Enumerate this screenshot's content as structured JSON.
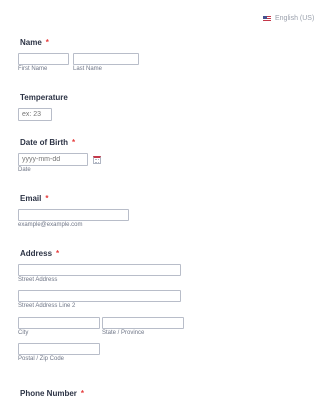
{
  "language": {
    "label": "English (US)",
    "icon": "us-flag-icon"
  },
  "fields": {
    "name": {
      "label": "Name",
      "required_mark": "*",
      "first_sub": "First Name",
      "last_sub": "Last Name"
    },
    "temperature": {
      "label": "Temperature",
      "placeholder": "ex: 23"
    },
    "dob": {
      "label": "Date of Birth",
      "required_mark": "*",
      "placeholder": "yyyy-mm-dd",
      "sub": "Date",
      "icon": "calendar-icon"
    },
    "email": {
      "label": "Email",
      "required_mark": "*",
      "sub": "example@example.com"
    },
    "address": {
      "label": "Address",
      "required_mark": "*",
      "street_sub": "Street Address",
      "street2_sub": "Street Address Line 2",
      "city_sub": "City",
      "state_sub": "State / Province",
      "postal_sub": "Postal / Zip Code"
    },
    "phone": {
      "label": "Phone Number",
      "required_mark": "*"
    }
  },
  "colors": {
    "required": "#e63d3d",
    "border": "#b8bdc9",
    "text": "#2c3345"
  }
}
